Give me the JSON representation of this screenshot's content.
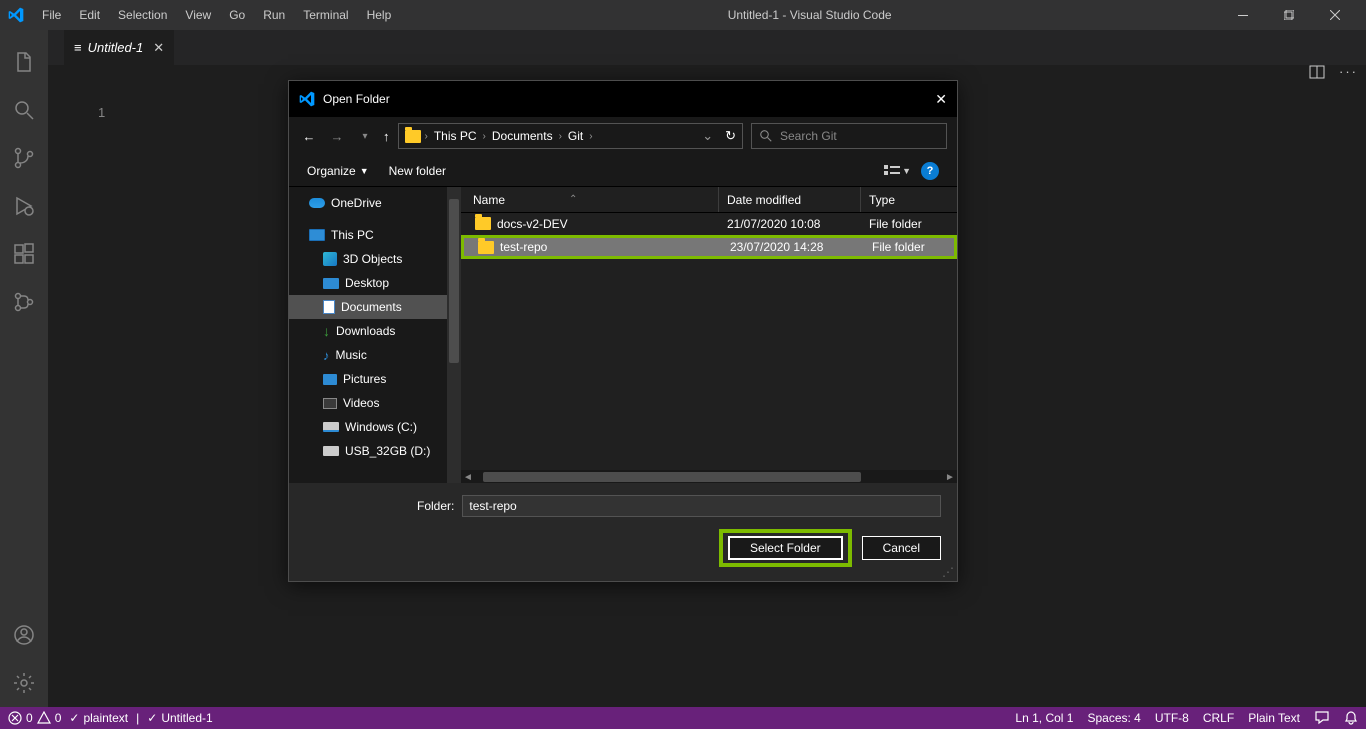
{
  "titlebar": {
    "menus": [
      "File",
      "Edit",
      "Selection",
      "View",
      "Go",
      "Run",
      "Terminal",
      "Help"
    ],
    "title": "Untitled-1 - Visual Studio Code"
  },
  "tab": {
    "name": "Untitled-1"
  },
  "line_number": "1",
  "statusbar": {
    "errors": "0",
    "warnings": "0",
    "lang_hint": "plaintext",
    "doc": "Untitled-1",
    "lncol": "Ln 1, Col 1",
    "spaces": "Spaces: 4",
    "encoding": "UTF-8",
    "eol": "CRLF",
    "mode": "Plain Text"
  },
  "dialog": {
    "title": "Open Folder",
    "breadcrumb": [
      "This PC",
      "Documents",
      "Git"
    ],
    "search_placeholder": "Search Git",
    "organize": "Organize",
    "newfolder": "New folder",
    "columns": {
      "name": "Name",
      "date": "Date modified",
      "type": "Type"
    },
    "rows": [
      {
        "name": "docs-v2-DEV",
        "date": "21/07/2020 10:08",
        "type": "File folder",
        "selected": false
      },
      {
        "name": "test-repo",
        "date": "23/07/2020 14:28",
        "type": "File folder",
        "selected": true,
        "highlight": true
      }
    ],
    "tree": {
      "onedrive": "OneDrive",
      "thispc": "This PC",
      "items": [
        "3D Objects",
        "Desktop",
        "Documents",
        "Downloads",
        "Music",
        "Pictures",
        "Videos",
        "Windows (C:)",
        "USB_32GB (D:)"
      ],
      "selected": "Documents"
    },
    "folder_label": "Folder:",
    "folder_value": "test-repo",
    "select_btn": "Select Folder",
    "cancel_btn": "Cancel"
  }
}
